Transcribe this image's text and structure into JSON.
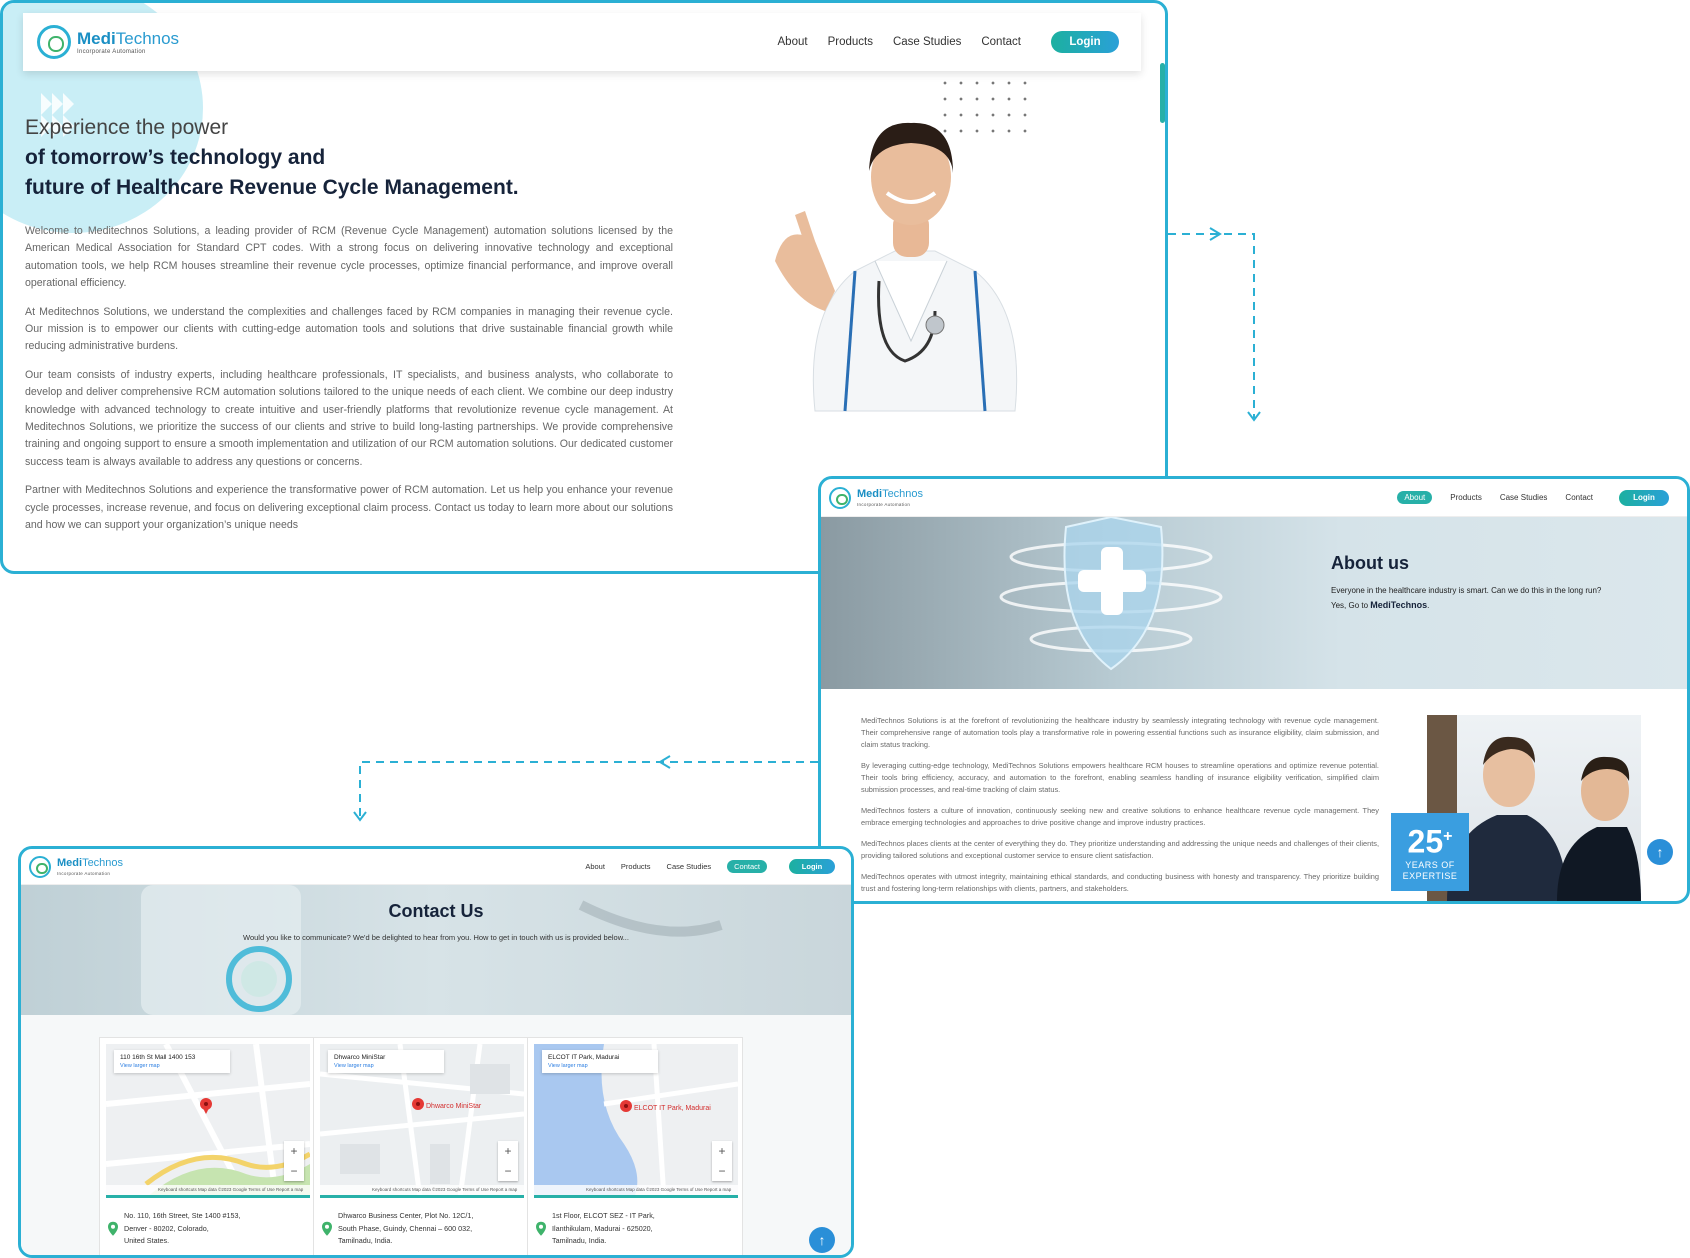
{
  "brand": {
    "name_part1": "Medi",
    "name_part2": "Technos",
    "tagline": "Incorporate Automation"
  },
  "nav": {
    "about": "About",
    "products": "Products",
    "case_studies": "Case Studies",
    "contact": "Contact",
    "login": "Login"
  },
  "hero": {
    "line1": "Experience the power",
    "line2": "of tomorrow’s technology and",
    "line3": "future of Healthcare Revenue Cycle Management.",
    "paragraphs": [
      "Welcome to Meditechnos Solutions, a leading provider of RCM (Revenue Cycle Management) automation solutions licensed by the American Medical Association for Standard CPT codes. With a strong focus on delivering innovative technology and exceptional automation tools, we help RCM houses streamline their revenue cycle processes, optimize financial performance, and improve overall operational efficiency.",
      "At Meditechnos Solutions, we understand the complexities and challenges faced by RCM companies in managing their revenue cycle. Our mission is to empower our clients with cutting-edge automation tools and solutions that drive sustainable financial growth while reducing administrative burdens.",
      "Our team consists of industry experts, including healthcare professionals, IT specialists, and business analysts, who collaborate to develop and deliver comprehensive RCM automation solutions tailored to the unique needs of each client. We combine our deep industry knowledge with advanced technology to create intuitive and user-friendly platforms that revolutionize revenue cycle management. At Meditechnos Solutions, we prioritize the success of our clients and strive to build long-lasting partnerships. We provide comprehensive training and ongoing support to ensure a smooth implementation and utilization of our RCM automation solutions. Our dedicated customer success team is always available to address any questions or concerns.",
      "Partner with Meditechnos Solutions and experience the transformative power of RCM automation. Let us help you enhance your revenue cycle processes, increase revenue, and focus on delivering exceptional claim process. Contact us today to learn more about our solutions and how we can support your organization’s unique needs"
    ]
  },
  "about": {
    "title": "About us",
    "subtitle": "Everyone in the healthcare industry is smart. Can we do this in the long run? Yes, Go to",
    "subtitle_brand": "MediTechnos",
    "subtitle_end": ".",
    "paragraphs": [
      "MediTechnos Solutions is at the forefront of revolutionizing the healthcare industry by seamlessly integrating technology with revenue cycle management. Their comprehensive range of automation tools play a transformative role in powering essential functions such as insurance eligibility, claim submission, and claim status tracking.",
      "By leveraging cutting-edge technology, MediTechnos Solutions empowers healthcare RCM houses to streamline operations and optimize revenue potential. Their tools bring efficiency, accuracy, and automation to the forefront, enabling seamless handling of insurance eligibility verification, simplified claim submission processes, and real-time tracking of claim status.",
      "MediTechnos fosters a culture of innovation, continuously seeking new and creative solutions to enhance healthcare revenue cycle management. They embrace emerging technologies and approaches to drive positive change and improve industry practices.",
      "MediTechnos places clients at the center of everything they do. They prioritize understanding and addressing the unique needs and challenges of their clients, providing tailored solutions and exceptional customer service to ensure client satisfaction.",
      "MediTechnos operates with utmost integrity, maintaining ethical standards, and conducting business with honesty and transparency. They prioritize building trust and fostering long-term relationships with clients, partners, and stakeholders."
    ],
    "expertise_number": "25",
    "expertise_plus": "+",
    "expertise_line1": "YEARS OF",
    "expertise_line2": "EXPERTISE"
  },
  "contact": {
    "title": "Contact Us",
    "subtitle": "Would you like to communicate? We'd be delighted to hear from you. How to get in touch with us is provided below...",
    "view_larger": "View larger map",
    "map_footer": "Keyboard shortcuts   Map data ©2023 Google   Terms of Use   Report a map error",
    "locations": [
      {
        "map_title": "110 16th St Mall 1400 153",
        "pin_label": "",
        "address": [
          "No. 110, 16th Street, Ste 1400 #153,",
          "Denver - 80202, Colorado,",
          "United States."
        ]
      },
      {
        "map_title": "Dhwarco MiniStar",
        "pin_label": "Dhwarco MiniStar",
        "address": [
          "Dhwarco Business Center, Plot No. 12C/1,",
          "South Phase, Guindy, Chennai – 600 032,",
          "Tamilnadu, India."
        ]
      },
      {
        "map_title": "ELCOT IT Park, Madurai",
        "pin_label": "ELCOT IT Park, Madurai",
        "address": [
          "1st Floor, ELCOT SEZ - IT Park,",
          "Ilanthikulam, Madurai - 625020,",
          "Tamilnadu, India."
        ]
      }
    ]
  },
  "colors": {
    "accent": "#2bb0d4",
    "teal": "#27b0a8",
    "navy": "#16233a"
  },
  "icons": [
    "logo-icon",
    "doctor-image",
    "shield-icon",
    "arrow-up-icon",
    "location-pin-icon",
    "map-pin-icon"
  ]
}
